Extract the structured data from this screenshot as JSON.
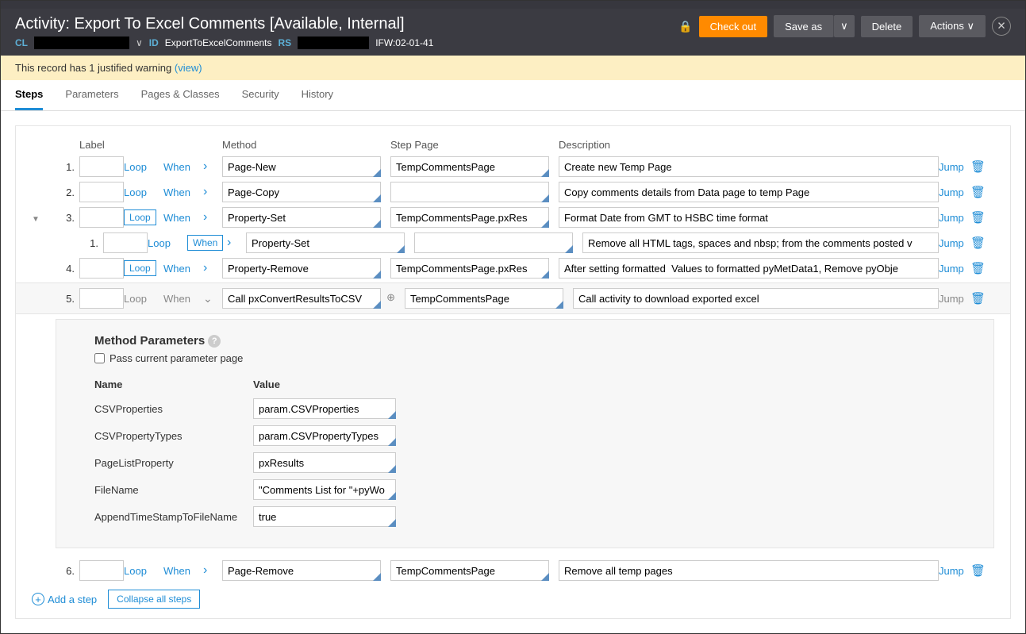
{
  "header": {
    "title": "Activity: Export To Excel Comments [Available, Internal]",
    "cl_label": "CL",
    "id_label": "ID",
    "id_value": "ExportToExcelComments",
    "rs_label": "RS",
    "rs_suffix": "IFW:02-01-41",
    "check_out": "Check out",
    "save_as": "Save as",
    "delete": "Delete",
    "actions": "Actions"
  },
  "warning": {
    "text": "This record has 1 justified warning ",
    "link": "(view)"
  },
  "tabs": {
    "steps": "Steps",
    "parameters": "Parameters",
    "pages": "Pages & Classes",
    "security": "Security",
    "history": "History"
  },
  "columns": {
    "label": "Label",
    "method": "Method",
    "step_page": "Step Page",
    "description": "Description"
  },
  "links": {
    "loop": "Loop",
    "when": "When",
    "jump": "Jump",
    "add_step": "Add a step",
    "collapse": "Collapse all steps"
  },
  "steps": [
    {
      "num": "1.",
      "method": "Page-New",
      "page": "TempCommentsPage",
      "desc": "Create new Temp Page"
    },
    {
      "num": "2.",
      "method": "Page-Copy",
      "page": "",
      "desc": "Copy comments details from Data page to temp Page"
    },
    {
      "num": "3.",
      "method": "Property-Set",
      "page": "TempCommentsPage.pxRes",
      "desc": "Format Date from GMT to HSBC time format"
    },
    {
      "num": "4.",
      "method": "Property-Remove",
      "page": "TempCommentsPage.pxRes",
      "desc": "After setting formatted  Values to formatted pyMetData1, Remove pyObje"
    },
    {
      "num": "5.",
      "method": "Call pxConvertResultsToCSV",
      "page": "TempCommentsPage",
      "desc": "Call activity to download exported excel"
    },
    {
      "num": "6.",
      "method": "Page-Remove",
      "page": "TempCommentsPage",
      "desc": "Remove all temp pages"
    }
  ],
  "substep": {
    "num": "1.",
    "method": "Property-Set",
    "page": "",
    "desc": "Remove all HTML tags, spaces and nbsp; from the comments posted v"
  },
  "method_params": {
    "title": "Method Parameters",
    "pass_param": "Pass current parameter page",
    "name_header": "Name",
    "value_header": "Value",
    "rows": [
      {
        "name": "CSVProperties",
        "value": "param.CSVProperties"
      },
      {
        "name": "CSVPropertyTypes",
        "value": "param.CSVPropertyTypes"
      },
      {
        "name": "PageListProperty",
        "value": "pxResults"
      },
      {
        "name": "FileName",
        "value": "\"Comments List for \"+pyWo"
      },
      {
        "name": "AppendTimeStampToFileName",
        "value": "true"
      }
    ]
  }
}
